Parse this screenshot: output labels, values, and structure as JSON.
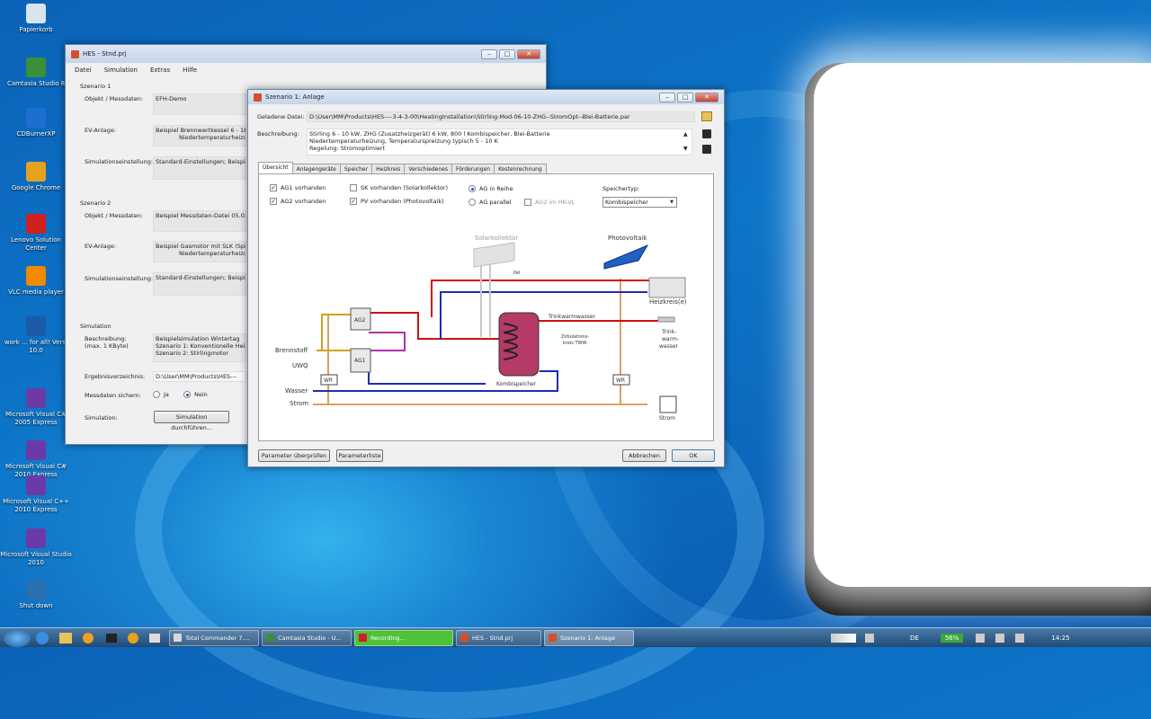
{
  "desktop": {
    "icons": [
      {
        "label": "Papierkorb",
        "color": "#d9e4ef"
      },
      {
        "label": "Camtasia Studio 8",
        "color": "#3a8f3a"
      },
      {
        "label": "CDBurnerXP",
        "color": "#1c6fd1"
      },
      {
        "label": "Google Chrome",
        "color": "#e5a21f"
      },
      {
        "label": "Lenovo Solution Center",
        "color": "#d12020"
      },
      {
        "label": "VLC media player",
        "color": "#f08a00"
      },
      {
        "label": "work ... for all! Versi 10.0",
        "color": "#1b5aa8"
      },
      {
        "label": "Microsoft Visual C# 2005 Express",
        "color": "#6c3aa7"
      },
      {
        "label": "Microsoft Visual C# 2010 Express",
        "color": "#6c3aa7"
      },
      {
        "label": "Microsoft Visual C++ 2010 Express",
        "color": "#6c3aa7"
      },
      {
        "label": "Microsoft Visual Studio 2010",
        "color": "#6c3aa7"
      },
      {
        "label": "Shut down",
        "color": "#2a6fb0"
      }
    ]
  },
  "main_window": {
    "title": "HES - Stnd.prj",
    "menu": [
      "Datei",
      "Simulation",
      "Extras",
      "Hilfe"
    ],
    "szenario1": {
      "header": "Szenario 1",
      "objekt_label": "Objekt / Messdaten:",
      "objekt_value": "EFH-Demo",
      "ev_label": "EV-Anlage:",
      "ev_value_1": "Beispiel Brennwertkessel 6 - 18 k",
      "ev_value_2": "Niedertemperaturheizun",
      "sim_label": "Simulationseinstellung:",
      "sim_value": "Standard-Einstellungen; Beispiel"
    },
    "szenario2": {
      "header": "Szenario 2",
      "objekt_label": "Objekt / Messdaten:",
      "objekt_value": "Beispiel Messdaten-Datei 05.02.",
      "ev_label": "EV-Anlage:",
      "ev_value_1": "Beispiel Gasmotor mit SLK (Spitz",
      "ev_value_2": "Niedertemperaturheizun",
      "sim_label": "Simulationseinstellung:",
      "sim_value": "Standard-Einstellungen; Beispiel"
    },
    "simulation": {
      "header": "Simulation",
      "beschr_label_1": "Beschreibung:",
      "beschr_label_2": "(max. 1 KByte)",
      "beschr_value_1": "Beispielsimulation Wintertag",
      "beschr_value_2": "Szenario 1: Konventionelle Heiz",
      "beschr_value_3": "Szenario 2: Stirlingmotor",
      "ergebnis_label": "Ergebnisverzeichnis:",
      "ergebnis_value": "D:\\User\\MM\\Products\\HES---",
      "mess_label": "Messdaten sichern:",
      "ja": "Ja",
      "nein": "Nein",
      "sim_label": "Simulation:",
      "sim_button": "Simulation durchführen..."
    }
  },
  "dialog": {
    "title": "Szenario 1: Anlage",
    "geladene_label": "Geladene Datei:",
    "geladene_value": "D:\\User\\MM\\Products\\HES----3-4-3-00\\HeatingInstallation\\Stirling-Mod-06-10-ZHG--StromOpt--Blei-Batterie.par",
    "beschr_label": "Beschreibung:",
    "beschr_lines": [
      "Stirling 6 - 10 kW,   ZHG (Zusatzheizgerät) 6 kW,   800 l Kombispeicher,   Blei-Batterie",
      "Niedertemperaturheizung, Temperaturspreizung typisch 5 - 10 K",
      "Regelung: Stromoptimiert"
    ],
    "tabs": [
      "Übersicht",
      "Anlagengeräte",
      "Speicher",
      "Heizkreis",
      "Verschiedenes",
      "Förderungen",
      "Kostenrechnung"
    ],
    "checks": {
      "ag1": "AG1 vorhanden",
      "ag2": "AG2 vorhanden",
      "sk": "SK vorhanden (Solarkollektor)",
      "pv": "PV vorhanden (Photovoltaik)",
      "reihe": "AG in Reihe",
      "parallel": "AG parallel",
      "ag2hk": "AG2 im HK-VL",
      "speichertyp_label": "Speichertyp:",
      "speichertyp_value": "Kombispeicher"
    },
    "diagram": {
      "solarkollektor": "Solarkollektor",
      "photovoltaik": "Photovoltaik",
      "heizkreis": "Heizkreis(e)",
      "trinkwarmwasser": "Trinkwarmwasser",
      "trink_label_1": "Trink-",
      "trink_label_2": "warm-",
      "trink_label_3": "wasser",
      "zirk_1": "Zirkulations-",
      "zirk_2": "kreis  TWW",
      "kombispeicher": "Kombispeicher",
      "brennstoff": "Brennstoff",
      "uwq": "UWQ",
      "wasser": "Wasser",
      "strom_left": "Strom",
      "strom_right": "Strom",
      "ag1": "AG1",
      "ag2": "AG2",
      "wr": "WR",
      "pel": "Pel"
    },
    "buttons": {
      "pruefen": "Parameter überprüfen",
      "liste": "Parameterliste",
      "abbrechen": "Abbrechen",
      "ok": "OK"
    }
  },
  "taskbar": {
    "items": [
      "Total Commander 7....",
      "Camtasia Studio - U...",
      "Recording...",
      "HES - Stnd.prj",
      "Szenario 1: Anlage"
    ],
    "lang": "DE",
    "battery": "56%",
    "time": "14:25"
  }
}
